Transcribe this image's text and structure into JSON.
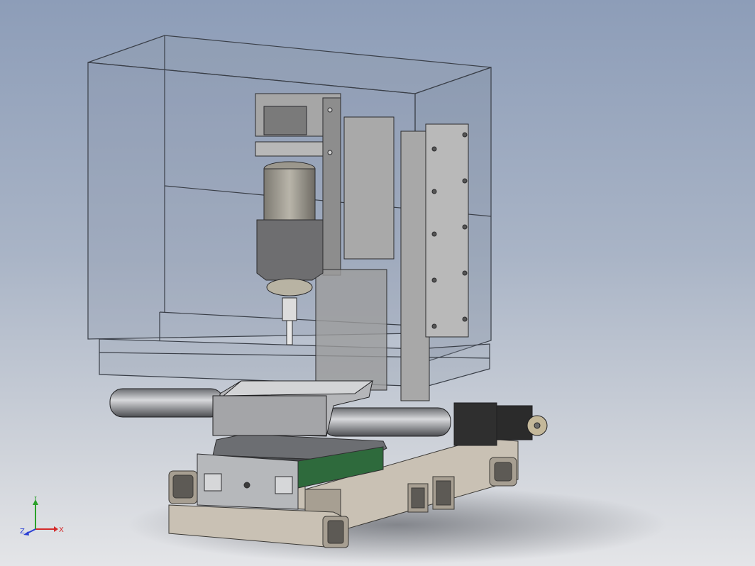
{
  "viewport": {
    "background_top": "#8d9db8",
    "background_bottom": "#e4e5e8"
  },
  "triad": {
    "x_label": "X",
    "y_label": "Y",
    "z_label": "Z",
    "x_color": "#d42a2a",
    "y_color": "#2aa12a",
    "z_color": "#2a3fd4"
  },
  "model": {
    "enclosure_color": "#8e9bab",
    "metal_color": "#b5b6b9",
    "frame_color": "#c9c1b4",
    "motor_color": "#2f2f2f"
  }
}
